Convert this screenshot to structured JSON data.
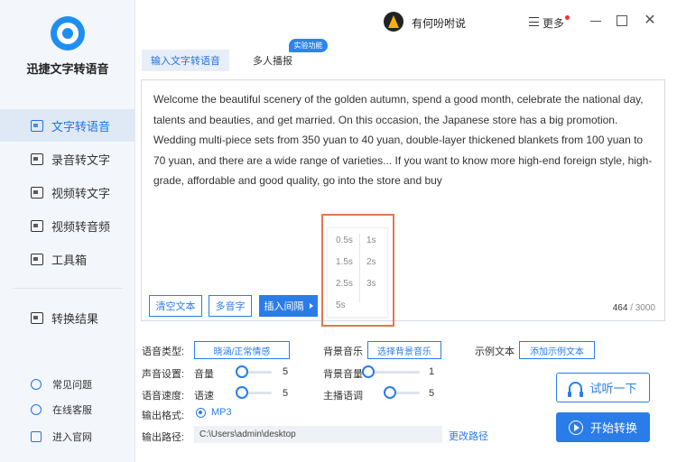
{
  "app": {
    "name": "迅捷文字转语音"
  },
  "sidebar": {
    "items": [
      {
        "label": "文字转语音",
        "active": true
      },
      {
        "label": "录音转文字"
      },
      {
        "label": "视频转文字"
      },
      {
        "label": "视频转音频"
      },
      {
        "label": "工具箱"
      },
      {
        "label": "转换结果"
      }
    ],
    "footer": [
      {
        "label": "常见问题"
      },
      {
        "label": "在线客服"
      },
      {
        "label": "进入官网"
      }
    ]
  },
  "header": {
    "username": "有何吩咐说",
    "more_label": "更多",
    "close_glyph": "✕"
  },
  "tabs": [
    {
      "label": "输入文字转语音",
      "active": true
    },
    {
      "label": "多人播报",
      "badge": "实验功能"
    }
  ],
  "editor": {
    "text": "Welcome the beautiful scenery of the golden autumn, spend a good month, celebrate the national day, talents and beauties, and get married. On this occasion, the Japanese store has a big promotion. Wedding multi-piece sets from 350 yuan to 40 yuan, double-layer thickened blankets from 100 yuan to 70 yuan, and there are a wide range of varieties... If you want to know more high-end foreign style, high-grade, affordable and good quality, go into the store and buy",
    "clear_btn": "清空文本",
    "polyphone_btn": "多音字",
    "insert_pause_btn": "插入间隔",
    "count": "464",
    "count_sep": "/",
    "max": "3000"
  },
  "pause_options": [
    "0.5s",
    "1s",
    "1.5s",
    "2s",
    "2.5s",
    "3s",
    "5s"
  ],
  "settings": {
    "voice_type_label": "语音类型:",
    "voice_type_value": "晓涵/正常情感",
    "bgm_label": "背景音乐",
    "bgm_btn": "选择背景音乐",
    "sample_label": "示例文本",
    "sample_btn": "添加示例文本",
    "sound_label": "声音设置:",
    "volume_label": "音量",
    "volume_value": "5",
    "bg_volume_label": "背景音量",
    "bg_volume_value": "1",
    "speed_label": "语音速度:",
    "speed_sub": "语速",
    "speed_value": "5",
    "pitch_label": "主播语调",
    "pitch_value": "5",
    "format_label": "输出格式:",
    "format_value": "MP3",
    "path_label": "输出路径:",
    "path_value": "C:\\Users\\admin\\desktop",
    "change_path": "更改路径"
  },
  "actions": {
    "listen": "试听一下",
    "start": "开始转换"
  },
  "colors": {
    "accent": "#2a7ce8",
    "highlight_frame": "#e0794f"
  }
}
